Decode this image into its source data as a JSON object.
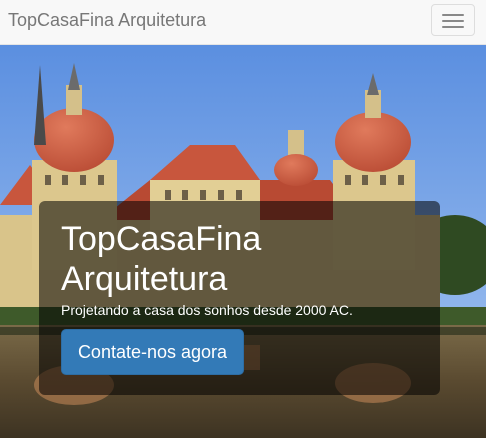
{
  "navbar": {
    "brand": "TopCasaFina Arquitetura",
    "toggle_icon": "hamburger-menu-icon"
  },
  "hero": {
    "image_subject": "baroque castle with red domes reflected in a lake",
    "headline": "TopCasaFina Arquitetura",
    "tagline": "Projetando a casa dos sonhos desde 2000 AC.",
    "cta_label": "Contate-nos agora"
  },
  "colors": {
    "navbar_bg": "#f8f8f8",
    "brand_text": "#777777",
    "cta_bg": "#337ab7",
    "overlay": "rgba(0,0,0,0.55)"
  }
}
